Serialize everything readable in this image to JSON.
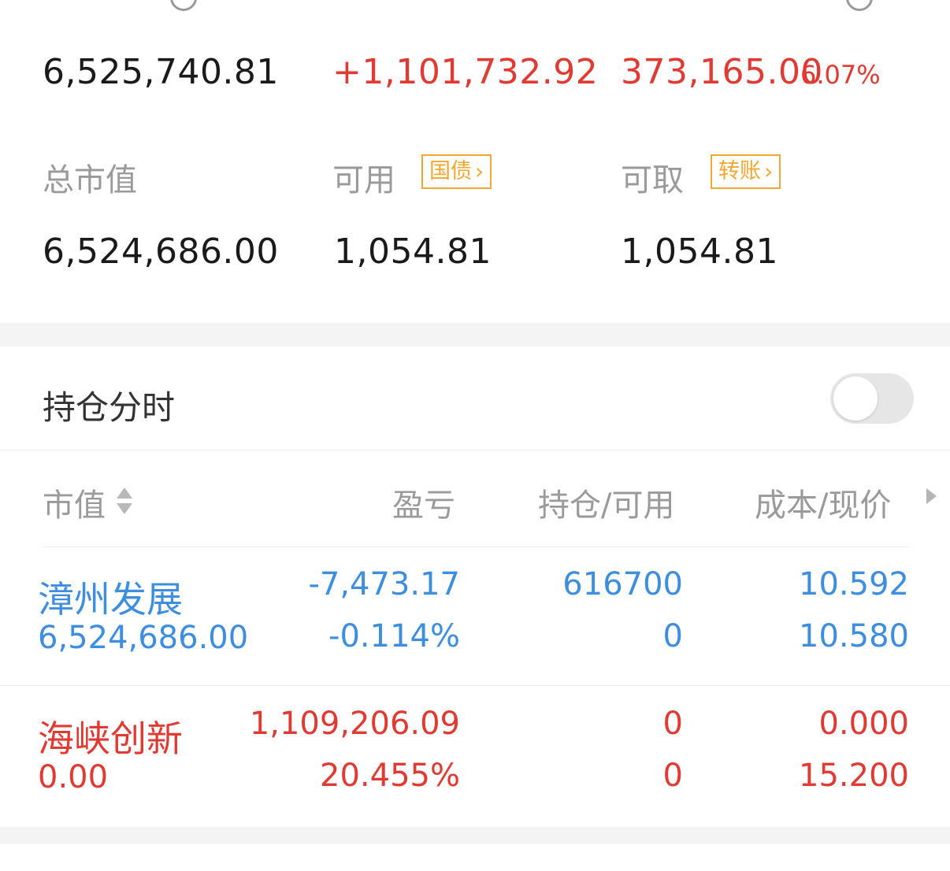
{
  "summary": {
    "total_assets": {
      "value": "6,525,740.81"
    },
    "total_pnl": {
      "value": "+1,101,732.92"
    },
    "today_ref_pnl": {
      "value": "373,165.00",
      "percent": "6.07%"
    },
    "market_value": {
      "label": "总市值",
      "value": "6,524,686.00"
    },
    "available": {
      "label": "可用",
      "badge": "国债",
      "value": "1,054.81"
    },
    "withdrawable": {
      "label": "可取",
      "badge": "转账",
      "value": "1,054.81"
    }
  },
  "holding_timeline": {
    "label": "持仓分时",
    "enabled": false
  },
  "table": {
    "headers": [
      "市值",
      "盈亏",
      "持仓/可用",
      "成本/现价"
    ],
    "rows": [
      {
        "name": "漳州发展",
        "market_value": "6,524,686.00",
        "pnl": "-7,473.17",
        "pnl_pct": "-0.114%",
        "position": "616700",
        "available": "0",
        "cost": "10.592",
        "price": "10.580"
      },
      {
        "name": "海峡创新",
        "market_value": "0.00",
        "pnl": "1,109,206.09",
        "pnl_pct": "20.455%",
        "position": "0",
        "available": "0",
        "cost": "0.000",
        "price": "15.200"
      }
    ]
  },
  "colors": {
    "profit": "#e03a32",
    "loss": "#3e8ee0",
    "badge": "#f2a72e",
    "muted": "#9a9a9a"
  }
}
